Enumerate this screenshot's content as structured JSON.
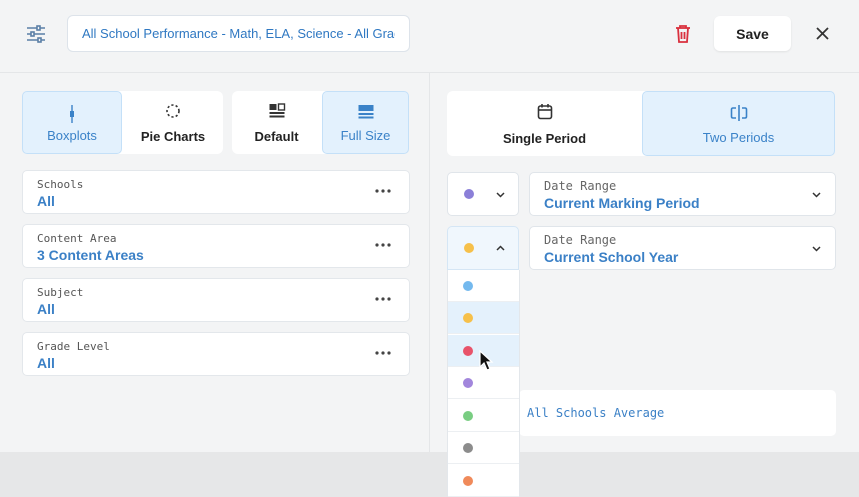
{
  "header": {
    "report_title": "All School Performance - Math, ELA, Science - All Grades",
    "save_label": "Save"
  },
  "chart_type": {
    "options": [
      {
        "label": "Boxplots",
        "active": true
      },
      {
        "label": "Pie Charts",
        "active": false
      }
    ]
  },
  "size_mode": {
    "options": [
      {
        "label": "Default",
        "active": false
      },
      {
        "label": "Full Size",
        "active": true
      }
    ]
  },
  "filters": [
    {
      "label": "Schools",
      "value": "All"
    },
    {
      "label": "Content Area",
      "value": "3 Content Areas"
    },
    {
      "label": "Subject",
      "value": "All"
    },
    {
      "label": "Grade Level",
      "value": "All"
    }
  ],
  "period_mode": {
    "options": [
      {
        "label": "Single Period",
        "active": false
      },
      {
        "label": "Two Periods",
        "active": true
      }
    ]
  },
  "periods": [
    {
      "color": "#8b7fd8",
      "label": "Date Range",
      "value": "Current Marking Period"
    },
    {
      "color": "#f6c04a",
      "label": "Date Range",
      "value": "Current School Year"
    }
  ],
  "average_label": "All Schools Average",
  "color_options": [
    {
      "color": "#74b9ee",
      "highlighted": false
    },
    {
      "color": "#f6c04a",
      "highlighted": true
    },
    {
      "color": "#e8536a",
      "highlighted": true
    },
    {
      "color": "#a286dc",
      "highlighted": false
    },
    {
      "color": "#79cd82",
      "highlighted": false
    },
    {
      "color": "#8c8c8c",
      "highlighted": false
    },
    {
      "color": "#f08a5a",
      "highlighted": false
    }
  ],
  "colors": {
    "accent": "#3b80c6",
    "active_bg": "#e3f1fd",
    "danger": "#d9303e"
  }
}
